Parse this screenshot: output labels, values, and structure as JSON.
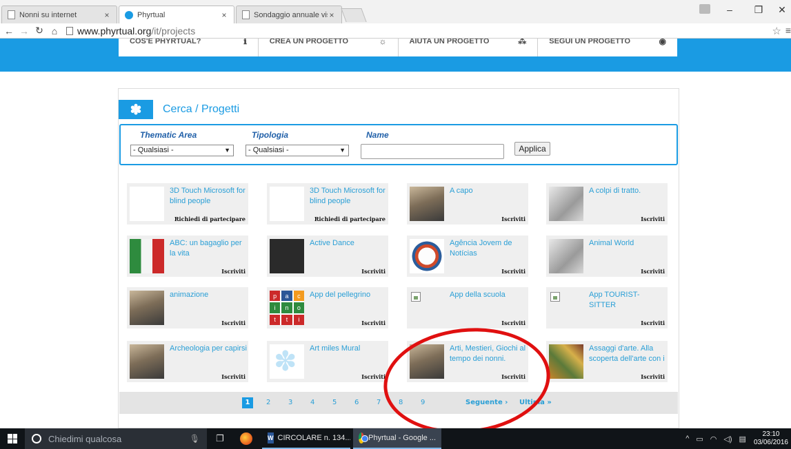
{
  "browser": {
    "tabs": [
      {
        "title": "Nonni su internet",
        "active": false
      },
      {
        "title": "Phyrtual",
        "active": true
      },
      {
        "title": "Sondaggio annuale visitat",
        "active": false
      }
    ],
    "url_host": "www.phyrtual.org",
    "url_path": "/it/projects",
    "close_glyph": "×"
  },
  "site_nav": [
    {
      "label": "COS'È PHYRTUAL?",
      "icon": "info-icon",
      "glyph": "ℹ"
    },
    {
      "label": "CREA UN PROGETTO",
      "icon": "lightbulb-icon",
      "glyph": "☼"
    },
    {
      "label": "AIUTA UN PROGETTO",
      "icon": "network-icon",
      "glyph": "⁂"
    },
    {
      "label": "SEGUI UN PROGETTO",
      "icon": "eye-icon",
      "glyph": "◉"
    }
  ],
  "search": {
    "title": "Cerca / Progetti",
    "filters": {
      "thematic_label": "Thematic Area",
      "thematic_value": "- Qualsiasi -",
      "tipologia_label": "Tipologia",
      "tipologia_value": "- Qualsiasi -",
      "name_label": "Name",
      "name_value": "",
      "apply_label": "Applica"
    }
  },
  "projects": [
    {
      "title": "3D Touch Microsoft for blind people",
      "action": "Richiedi di partecipare",
      "thumb": "blank"
    },
    {
      "title": "3D Touch Microsoft for blind people",
      "action": "Richiedi di partecipare",
      "thumb": "blank"
    },
    {
      "title": "A capo",
      "action": "Iscriviti",
      "thumb": "photo"
    },
    {
      "title": "A colpi di tratto.",
      "action": "Iscriviti",
      "thumb": "sketch"
    },
    {
      "title": "ABC: un bagaglio per la vita",
      "action": "Iscriviti",
      "thumb": "book"
    },
    {
      "title": "Active Dance",
      "action": "Iscriviti",
      "thumb": "dark"
    },
    {
      "title": "Agência Jovem de Notícias",
      "action": "Iscriviti",
      "thumb": "logo"
    },
    {
      "title": "Animal World",
      "action": "Iscriviti",
      "thumb": "sketch"
    },
    {
      "title": "animazione",
      "action": "Iscriviti",
      "thumb": "photo"
    },
    {
      "title": "App del pellegrino",
      "action": "Iscriviti",
      "thumb": "letters"
    },
    {
      "title": "App della scuola",
      "action": "Iscriviti",
      "thumb": "broken"
    },
    {
      "title": "App TOURIST-SITTER",
      "action": "Iscriviti",
      "thumb": "broken"
    },
    {
      "title": "Archeologia per capirsi",
      "action": "Iscriviti",
      "thumb": "photo"
    },
    {
      "title": "Art miles Mural",
      "action": "Iscriviti",
      "thumb": "phylogo"
    },
    {
      "title": "Arti, Mestieri, Giochi al tempo dei nonni.",
      "action": "Iscriviti",
      "thumb": "photo"
    },
    {
      "title": "Assaggi d'arte. Alla scoperta dell'arte con i",
      "action": "Iscriviti",
      "thumb": "colorful"
    }
  ],
  "letters_thumb": [
    "p",
    "a",
    "c",
    "i",
    "n",
    "o",
    "t",
    "t",
    "i"
  ],
  "pager": {
    "current": "1",
    "pages": [
      "2",
      "3",
      "4",
      "5",
      "6",
      "7",
      "8",
      "9"
    ],
    "next_label": "Seguente ›",
    "last_label": "Ultima »"
  },
  "taskbar": {
    "search_placeholder": "Chiedimi qualcosa",
    "apps": [
      {
        "label": "CIRCOLARE n. 134....",
        "icon": "word-icon"
      },
      {
        "label": "Phyrtual - Google ...",
        "icon": "chrome-icon"
      }
    ],
    "time": "23:10",
    "date": "03/06/2016"
  },
  "colors": {
    "brand_blue": "#1a9be3",
    "link_blue": "#2a9fd6",
    "label_blue": "#1f5fa8",
    "annotation_red": "#e01010"
  }
}
